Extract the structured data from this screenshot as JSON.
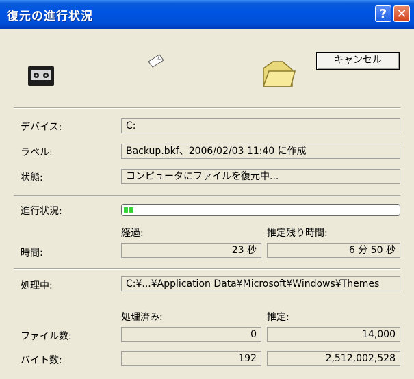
{
  "window": {
    "title": "復元の進行状況",
    "help_symbol": "?",
    "close_symbol": "✕"
  },
  "buttons": {
    "cancel": "キャンセル"
  },
  "icons": {
    "tape": "tape-drive-icon",
    "flying_page": "flying-document-icon",
    "folder": "open-folder-icon"
  },
  "info": {
    "device_label": "デバイス:",
    "device_value": "C:",
    "label_label": "ラベル:",
    "label_value": "Backup.bkf、2006/02/03 11:40 に作成",
    "status_label": "状態:",
    "status_value": "コンピュータにファイルを復元中..."
  },
  "progress": {
    "label": "進行状況:",
    "fraction": 0.04
  },
  "time": {
    "label": "時間:",
    "elapsed_header": "経過:",
    "remaining_header": "推定残り時間:",
    "elapsed": "23 秒",
    "remaining": "6 分 50 秒"
  },
  "processing": {
    "label": "処理中:",
    "value": "C:¥...¥Application Data¥Microsoft¥Windows¥Themes"
  },
  "counts": {
    "processed_header": "処理済み:",
    "estimated_header": "推定:",
    "files_label": "ファイル数:",
    "files_processed": "0",
    "files_estimated": "14,000",
    "bytes_label": "バイト数:",
    "bytes_processed": "192",
    "bytes_estimated": "2,512,002,528"
  }
}
